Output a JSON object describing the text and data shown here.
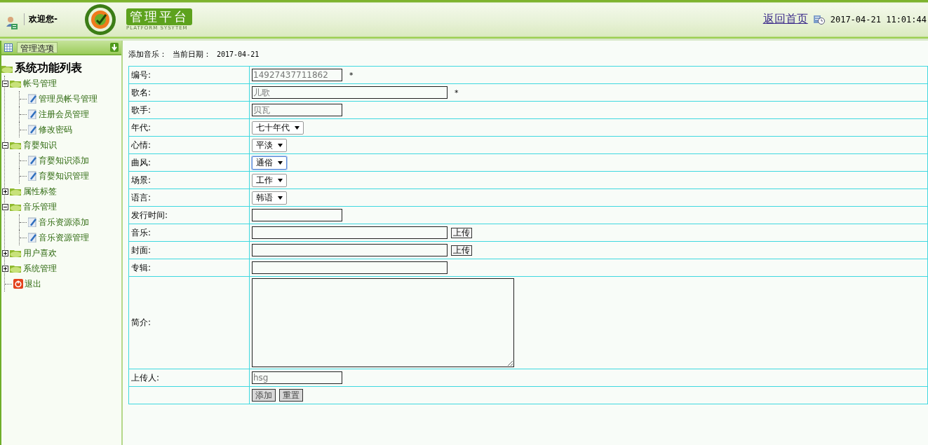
{
  "header": {
    "welcome": "欢迎您-",
    "logo_title": "管理平台",
    "logo_subtitle": "PLATFORM SYSYTEM",
    "home_link": "返回首页",
    "datetime": "2017-04-21 11:01:44"
  },
  "sidebar": {
    "options_button": "管理选项",
    "tree": {
      "label": "系统功能列表",
      "children": [
        {
          "label": "帐号管理",
          "kind": "folder",
          "expanded": true,
          "children": [
            {
              "label": "管理员帐号管理",
              "kind": "page"
            },
            {
              "label": "注册会员管理",
              "kind": "page"
            },
            {
              "label": "修改密码",
              "kind": "page"
            }
          ]
        },
        {
          "label": "育婴知识",
          "kind": "folder",
          "expanded": true,
          "children": [
            {
              "label": "育婴知识添加",
              "kind": "page"
            },
            {
              "label": "育婴知识管理",
              "kind": "page"
            }
          ]
        },
        {
          "label": "属性标签",
          "kind": "folder",
          "expanded": false
        },
        {
          "label": "音乐管理",
          "kind": "folder",
          "expanded": true,
          "children": [
            {
              "label": "音乐资源添加",
              "kind": "page"
            },
            {
              "label": "音乐资源管理",
              "kind": "page"
            }
          ]
        },
        {
          "label": "用户喜欢",
          "kind": "folder",
          "expanded": false
        },
        {
          "label": "系统管理",
          "kind": "folder",
          "expanded": false
        },
        {
          "label": "退出",
          "kind": "exit"
        }
      ]
    }
  },
  "breadcrumb": {
    "title": "添加音乐：",
    "date_label": "当前日期：",
    "date": "2017-04-21"
  },
  "form": {
    "rows": [
      {
        "label": "编号:",
        "kind": "short-text",
        "value": "14927437711862",
        "required": "*"
      },
      {
        "label": "歌名:",
        "kind": "long-text",
        "value": "儿歌",
        "required": "*"
      },
      {
        "label": "歌手:",
        "kind": "short-text",
        "value": "贝瓦"
      },
      {
        "label": "年代:",
        "kind": "select",
        "value": "七十年代",
        "focused": false
      },
      {
        "label": "心情:",
        "kind": "select",
        "value": "平淡",
        "focused": false
      },
      {
        "label": "曲风:",
        "kind": "select",
        "value": "通俗",
        "focused": true
      },
      {
        "label": "场景:",
        "kind": "select",
        "value": "工作",
        "focused": false
      },
      {
        "label": "语言:",
        "kind": "select",
        "value": "韩语",
        "focused": false
      },
      {
        "label": "发行时间:",
        "kind": "short-text"
      },
      {
        "label": "音乐:",
        "kind": "upload",
        "button": "上传"
      },
      {
        "label": "封面:",
        "kind": "upload",
        "button": "上传"
      },
      {
        "label": "专辑:",
        "kind": "long-text"
      },
      {
        "label": "简介:",
        "kind": "textarea"
      },
      {
        "label": "上传人:",
        "kind": "short-text",
        "value": "hsg"
      },
      {
        "kind": "buttons",
        "buttons": [
          "添加",
          "重置"
        ]
      }
    ]
  }
}
